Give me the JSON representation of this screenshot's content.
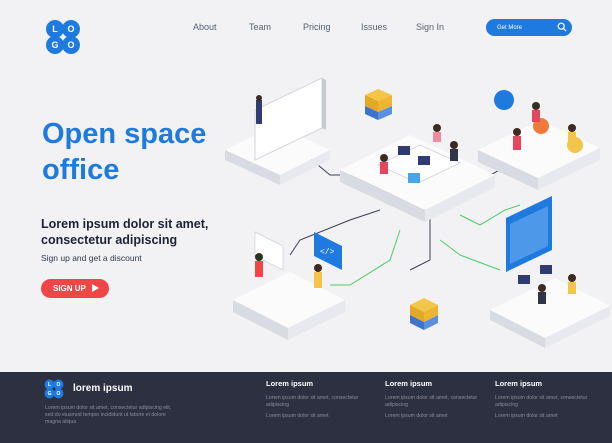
{
  "header": {
    "logo_text": "LOGO",
    "nav": [
      "About",
      "Team",
      "Pricing",
      "Issues",
      "Sign In"
    ],
    "cta_label": "Get More",
    "cta_icon": "search-icon"
  },
  "hero": {
    "title_line1": "Open space",
    "title_line2": "office",
    "subtitle_line1": "Lorem ipsum dolor sit amet,",
    "subtitle_line2": "consectetur adipiscing",
    "tagline": "Sign up and get a discount",
    "signup_label": "SIGN UP",
    "screen_code_label": "</>"
  },
  "footer": {
    "brand": "lorem ipsum",
    "about_text": "Lorem ipsum dolor sit amet, consectetur adipiscing elit, sed do eiusmod tempor incididunt ut labore et dolore magna aliqua",
    "columns": [
      {
        "title": "Lorem ipsum",
        "line1": "Lorem ipsum dolor sit amet, consectetur adipiscing",
        "line2": "Lorem ipsum dolor sit amet"
      },
      {
        "title": "Lorem ipsum",
        "line1": "Lorem ipsum dolor sit amet, consectetur adipiscing",
        "line2": "Lorem ipsum dolor sit amet"
      },
      {
        "title": "Lorem ipsum",
        "line1": "Lorem ipsum dolor sit amet, consectetur adipiscing",
        "line2": "Lorem ipsum dolor sit amet"
      }
    ]
  },
  "colors": {
    "accent": "#1f7ae0",
    "signup": "#f14646",
    "footer_bg": "#2c3040",
    "title_dark": "#1c2136"
  }
}
